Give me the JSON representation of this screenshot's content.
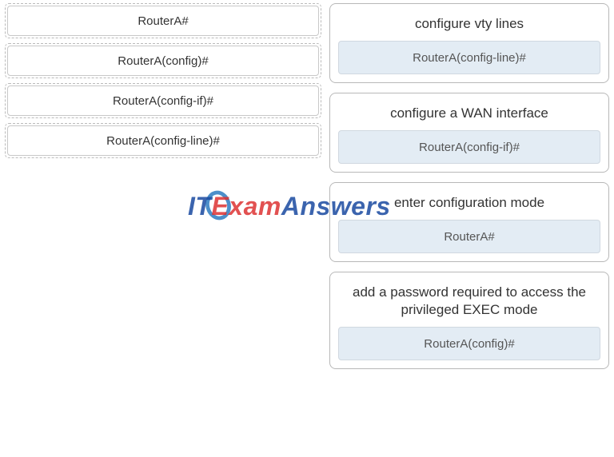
{
  "sources": [
    {
      "label": "RouterA#"
    },
    {
      "label": "RouterA(config)#"
    },
    {
      "label": "RouterA(config-if)#"
    },
    {
      "label": "RouterA(config-line)#"
    }
  ],
  "targets": [
    {
      "label": "configure vty lines",
      "answer": "RouterA(config-line)#"
    },
    {
      "label": "configure a WAN interface",
      "answer": "RouterA(config-if)#"
    },
    {
      "label": "enter configuration mode",
      "answer": "RouterA#"
    },
    {
      "label": "add a password required to access the privileged EXEC mode",
      "answer": "RouterA(config)#"
    }
  ],
  "watermark": {
    "it": "IT",
    "exam": "Exam",
    "answers": "Answers"
  }
}
